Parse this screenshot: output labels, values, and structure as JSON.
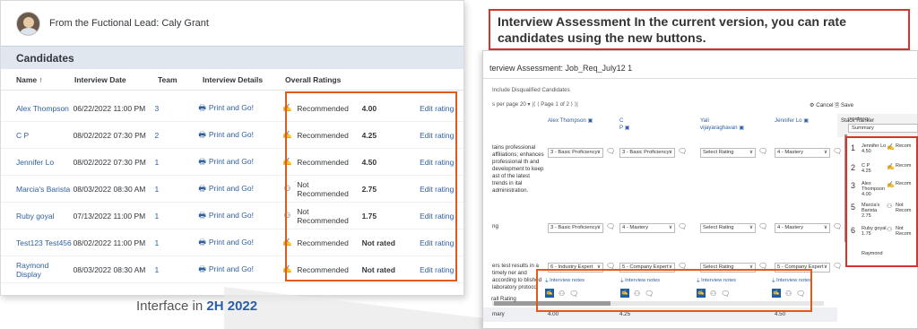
{
  "left": {
    "lead_text": "From the Fuctional Lead: Caly Grant",
    "section_title": "Candidates",
    "columns": [
      "Name ↑",
      "Interview Date",
      "Team",
      "Interview Details",
      "Overall Ratings"
    ],
    "rows": [
      {
        "name": "Alex Thompson",
        "date": "06/22/2022 11:00 PM",
        "team": "3",
        "details": "Print and Go!",
        "rec": "Recommended",
        "score": "4.00",
        "edit": "Edit rating",
        "recommended": true
      },
      {
        "name": "C P",
        "date": "08/02/2022 07:30 PM",
        "team": "2",
        "details": "Print and Go!",
        "rec": "Recommended",
        "score": "4.25",
        "edit": "Edit rating",
        "recommended": true
      },
      {
        "name": "Jennifer Lo",
        "date": "08/02/2022 07:30 PM",
        "team": "1",
        "details": "Print and Go!",
        "rec": "Recommended",
        "score": "4.50",
        "edit": "Edit rating",
        "recommended": true
      },
      {
        "name": "Marcia's Barista",
        "date": "08/03/2022 08:30 AM",
        "team": "1",
        "details": "Print and Go!",
        "rec": "Not Recommended",
        "score": "2.75",
        "edit": "Edit rating",
        "recommended": false
      },
      {
        "name": "Ruby goyal",
        "date": "07/13/2022 11:00 PM",
        "team": "1",
        "details": "Print and Go!",
        "rec": "Not Recommended",
        "score": "1.75",
        "edit": "Edit rating",
        "recommended": false
      },
      {
        "name": "Test123 Test456",
        "date": "08/02/2022 11:00 PM",
        "team": "1",
        "details": "Print and Go!",
        "rec": "Recommended",
        "score": "Not rated",
        "edit": "Edit rating",
        "recommended": true
      },
      {
        "name": "Raymond Display",
        "date": "08/03/2022 08:30 AM",
        "team": "1",
        "details": "Print and Go!",
        "rec": "Recommended",
        "score": "Not rated",
        "edit": "Edit rating",
        "recommended": true
      }
    ]
  },
  "caption": {
    "prefix": "Interface in ",
    "highlight": "2H 2022"
  },
  "callout": "Interview Assessment In the current version, you can rate candidates using the new buttons.",
  "right": {
    "title": "terview Assessment:  Job_Req_July12 1",
    "include_disqualified": "Include Disqualified Candidates",
    "pager": "s per page  20  ▾    |⟨  ⟨  Page  1  of 2  ⟩  ⟩|",
    "cancel": "⚙ Cancel   🗎 Save",
    "candidates": [
      {
        "line1": "Alex Thompson",
        "line2": ""
      },
      {
        "line1": "C",
        "line2": "P"
      },
      {
        "line1": "Yali",
        "line2": "vijayaraghavan"
      },
      {
        "line1": "Jennifer Lo",
        "line2": ""
      }
    ],
    "stack_ranker": "Stack Ranker",
    "competency_label": "mpetency",
    "summary_select": "Summary",
    "competencies": [
      "tains professional affiliations; enhances professional th and development to keep ast of the latest trends in ital administration.",
      "ng",
      "ers test results in a timely ner and according to blished laboratory protocol"
    ],
    "ratings": [
      [
        "3 - Basic Proficiency",
        "3 - Basic Proficiency",
        "Select Rating",
        "4 - Mastery"
      ],
      [
        "3 - Basic Proficiency",
        "4 - Mastery",
        "Select Rating",
        "4 - Mastery"
      ],
      [
        "6 - Industry Expert",
        "5 - Company Expert",
        "Select Rating",
        "5 - Company Expert"
      ]
    ],
    "summary_label": "mary",
    "summary_values": [
      "4.00",
      "4.25",
      "",
      "4.50"
    ],
    "overall_label": "rall Rating",
    "notes_label": "Interview notes",
    "stack": [
      {
        "num": "1",
        "name": "Jennifer Lo\n4.50",
        "rec": "Recom"
      },
      {
        "num": "2",
        "name": "C P\n4.25",
        "rec": "Recom"
      },
      {
        "num": "3",
        "name": "Alex\nThompson\n4.00",
        "rec": "Recom"
      },
      {
        "num": "5",
        "name": "Marcia's\nBarista\n2.75",
        "rec": "Not\nRecom"
      },
      {
        "num": "6",
        "name": "Ruby goyal\n1.75",
        "rec": "Not\nRecom"
      },
      {
        "num": "",
        "name": "Raymond",
        "rec": ""
      }
    ]
  },
  "colors": {
    "accent_box": "#e05a1a",
    "callout_border": "#d9342b",
    "link": "#2f5f9e"
  }
}
